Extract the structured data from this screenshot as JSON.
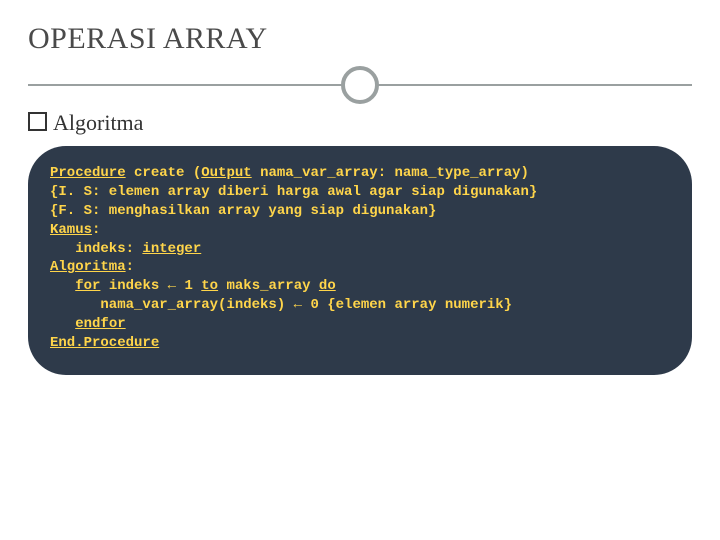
{
  "title": "OPERASI ARRAY",
  "subtitle": "Algoritma",
  "code": {
    "l1a": "Procedure",
    "l1b": " create (",
    "l1c": "Output",
    "l1d": " nama_var_array: nama_type_array)",
    "l2": "{I. S: elemen array diberi harga awal agar siap digunakan}",
    "l3": "{F. S: menghasilkan array yang siap digunakan}",
    "l4a": "Kamus",
    "l4b": ":",
    "l5a": "   indeks: ",
    "l5b": "integer",
    "l6a": "Algoritma",
    "l6b": ":",
    "l7a": "   ",
    "l7b": "for",
    "l7c": " indeks ",
    "l7d": "←",
    "l7e": " 1 ",
    "l7f": "to",
    "l7g": " maks_array ",
    "l7h": "do",
    "l8a": "      nama_var_array(indeks) ",
    "l8b": "←",
    "l8c": " 0 {elemen array numerik}",
    "l9": "   ",
    "l9b": "endfor",
    "l10": "End.Procedure"
  }
}
